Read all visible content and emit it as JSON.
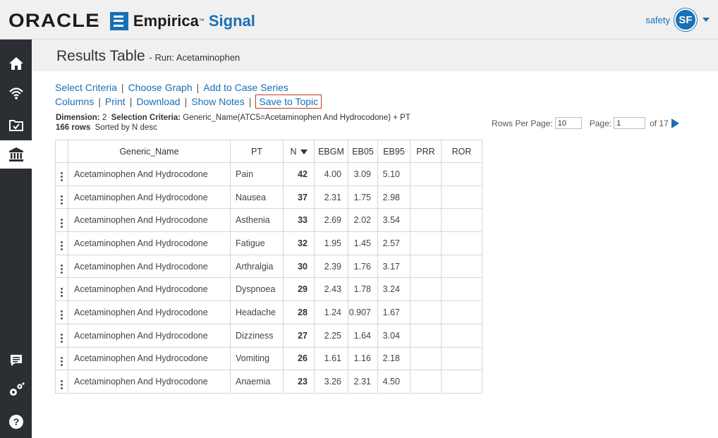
{
  "brand": {
    "company": "ORACLE",
    "product_1": "Empirica",
    "product_2": "Signal"
  },
  "user": {
    "name": "safety",
    "initials": "SF"
  },
  "sidebar": {
    "icons": [
      "home-icon",
      "wifi-signal-icon",
      "folder-check-icon",
      "bank-icon",
      "comment-icon",
      "settings-icon",
      "help-icon"
    ]
  },
  "page": {
    "title": "Results Table",
    "subtitle": "- Run: Acetaminophen"
  },
  "actions": {
    "row1": [
      "Select Criteria",
      "Choose Graph",
      "Add to Case Series"
    ],
    "row2": [
      "Columns",
      "Print",
      "Download",
      "Show Notes",
      "Save to Topic"
    ]
  },
  "criteria": {
    "dimension_label": "Dimension:",
    "dimension_value": "2",
    "selection_label": "Selection Criteria:",
    "selection_value": "Generic_Name(ATC5=Acetaminophen And Hydrocodone) + PT",
    "rows_count": "166 rows",
    "sorted": "Sorted by N desc"
  },
  "pager": {
    "rows_label": "Rows Per Page:",
    "rows_value": "10",
    "page_label": "Page:",
    "page_value": "1",
    "of_label": "of 17"
  },
  "table": {
    "headers": {
      "name": "Generic_Name",
      "pt": "PT",
      "n": "N",
      "ebgm": "EBGM",
      "eb05": "EB05",
      "eb95": "EB95",
      "prr": "PRR",
      "ror": "ROR"
    },
    "rows": [
      {
        "name": "Acetaminophen And Hydrocodone",
        "pt": "Pain",
        "n": "42",
        "ebgm": "4.00",
        "eb05": "3.09",
        "eb95": "5.10",
        "prr": "",
        "ror": ""
      },
      {
        "name": "Acetaminophen And Hydrocodone",
        "pt": "Nausea",
        "n": "37",
        "ebgm": "2.31",
        "eb05": "1.75",
        "eb95": "2.98",
        "prr": "",
        "ror": ""
      },
      {
        "name": "Acetaminophen And Hydrocodone",
        "pt": "Asthenia",
        "n": "33",
        "ebgm": "2.69",
        "eb05": "2.02",
        "eb95": "3.54",
        "prr": "",
        "ror": ""
      },
      {
        "name": "Acetaminophen And Hydrocodone",
        "pt": "Fatigue",
        "n": "32",
        "ebgm": "1.95",
        "eb05": "1.45",
        "eb95": "2.57",
        "prr": "",
        "ror": ""
      },
      {
        "name": "Acetaminophen And Hydrocodone",
        "pt": "Arthralgia",
        "n": "30",
        "ebgm": "2.39",
        "eb05": "1.76",
        "eb95": "3.17",
        "prr": "",
        "ror": ""
      },
      {
        "name": "Acetaminophen And Hydrocodone",
        "pt": "Dyspnoea",
        "n": "29",
        "ebgm": "2.43",
        "eb05": "1.78",
        "eb95": "3.24",
        "prr": "",
        "ror": ""
      },
      {
        "name": "Acetaminophen And Hydrocodone",
        "pt": "Headache",
        "n": "28",
        "ebgm": "1.24",
        "eb05": "0.907",
        "eb95": "1.67",
        "prr": "",
        "ror": ""
      },
      {
        "name": "Acetaminophen And Hydrocodone",
        "pt": "Dizziness",
        "n": "27",
        "ebgm": "2.25",
        "eb05": "1.64",
        "eb95": "3.04",
        "prr": "",
        "ror": ""
      },
      {
        "name": "Acetaminophen And Hydrocodone",
        "pt": "Vomiting",
        "n": "26",
        "ebgm": "1.61",
        "eb05": "1.16",
        "eb95": "2.18",
        "prr": "",
        "ror": ""
      },
      {
        "name": "Acetaminophen And Hydrocodone",
        "pt": "Anaemia",
        "n": "23",
        "ebgm": "3.26",
        "eb05": "2.31",
        "eb95": "4.50",
        "prr": "",
        "ror": ""
      }
    ]
  },
  "colors": {
    "accent": "#1a6fb5",
    "sidebar": "#2b2f33",
    "highlight_border": "#c0392b"
  }
}
